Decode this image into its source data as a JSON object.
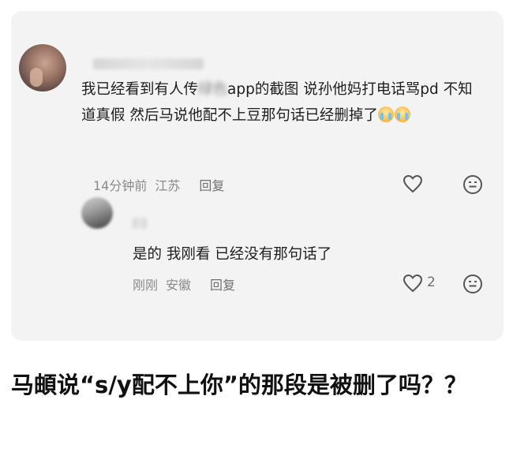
{
  "comment": {
    "text_before": "我已经看到有人传",
    "text_blurred": "绿色",
    "text_after": "app的截图 说孙他妈打电话骂pd  不知道真假 然后马说他配不上豆那句话已经删掉了",
    "time": "14分钟前",
    "location": "江苏",
    "reply_label": "回复"
  },
  "reply": {
    "text": "是的  我刚看  已经没有那句话了",
    "time": "刚刚",
    "location": "安徽",
    "reply_label": "回复",
    "like_count": "2"
  },
  "headline": "马頔说“s/y配不上你”的那段是被删了吗？？"
}
